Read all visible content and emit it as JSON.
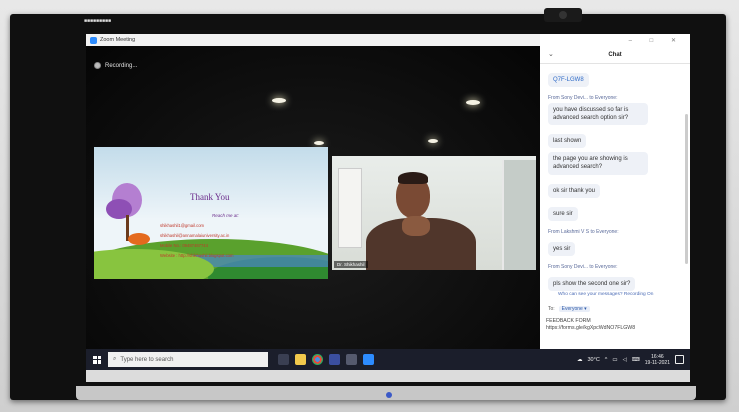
{
  "tv": {
    "label": "■■■■■■■■■",
    "brand": ""
  },
  "zoom": {
    "window_title": "Zoom Meeting",
    "recording_label": "Recording..."
  },
  "slide": {
    "title": "Thank You",
    "reach": "Reach me at:",
    "lines": [
      "shikhashil1@gmail.com",
      "shikhashil@annamalaiuniversity.ac.in",
      "Mobile No.: 09487467744",
      "Website : http://shikhashil.blogspot.com"
    ]
  },
  "video": {
    "name_label": "Dr. Shikhashil"
  },
  "chat": {
    "title": "Chat",
    "messages": [
      {
        "from": "",
        "text": "Q7F-LGW8",
        "is_link": true
      },
      {
        "from": "From Sony Devi... to Everyone:",
        "text": "you have discussed so far is advanced search option sir?",
        "is_link": false
      },
      {
        "from": "",
        "text": "last shown",
        "is_link": false
      },
      {
        "from": "",
        "text": "the page you are showing is advanced search?",
        "is_link": false
      },
      {
        "from": "",
        "text": "ok sir thank you",
        "is_link": false
      },
      {
        "from": "",
        "text": "sure sir",
        "is_link": false
      },
      {
        "from": "From Lakshmi V S to Everyone:",
        "text": "yes sir",
        "is_link": false
      },
      {
        "from": "From Sony Devi... to Everyone:",
        "text": "pls show the second one sir?",
        "is_link": false
      }
    ],
    "info": "Who can see your messages? Recording On",
    "to_label": "To:",
    "to_value": "Everyone ▾",
    "input_text": "FEEDBACK FORM\nhttps://forms.gle/kgXpcWdNO7FLGW8"
  },
  "taskbar": {
    "search_placeholder": "Type here to search",
    "weather": "30°C",
    "time": "16:46",
    "date": "19-11-2021"
  },
  "colors": {
    "taskbar": "#1b1e2b",
    "zoom_blue": "#2d8cff",
    "chat_link": "#2d6ac7"
  }
}
